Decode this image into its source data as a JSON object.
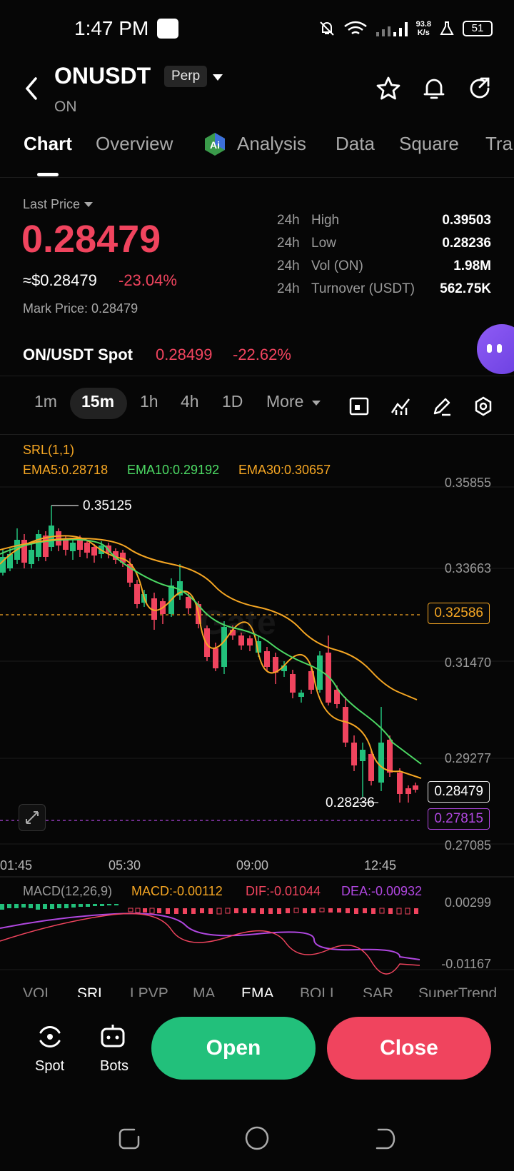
{
  "status_bar": {
    "time": "1:47 PM",
    "net_speed_value": "93.8",
    "net_speed_unit": "K/s",
    "battery": "51"
  },
  "header": {
    "symbol": "ONUSDT",
    "badge": "Perp",
    "subtitle": "ON"
  },
  "tabs": [
    {
      "label": "Chart",
      "active": true
    },
    {
      "label": "Overview"
    },
    {
      "label": "Analysis"
    },
    {
      "label": "Data"
    },
    {
      "label": "Square"
    },
    {
      "label": "Tra"
    }
  ],
  "price": {
    "last_price_label": "Last Price",
    "last_price": "0.28479",
    "usd_price": "≈$0.28479",
    "change": "-23.04%",
    "mark_price": "Mark Price: 0.28479"
  },
  "stats": [
    {
      "period": "24h",
      "label": "High",
      "value": "0.39503"
    },
    {
      "period": "24h",
      "label": "Low",
      "value": "0.28236"
    },
    {
      "period": "24h",
      "label": "Vol (ON)",
      "value": "1.98M"
    },
    {
      "period": "24h",
      "label": "Turnover (USDT)",
      "value": "562.75K"
    }
  ],
  "spot": {
    "label": "ON/USDT Spot",
    "price": "0.28499",
    "change": "-22.62%"
  },
  "timeframes": [
    "1m",
    "15m",
    "1h",
    "4h",
    "1D",
    "More"
  ],
  "active_timeframe": "15m",
  "indicators": {
    "srl": "SRL(1,1)",
    "ema5": "EMA5:0.28718",
    "ema10": "EMA10:0.29192",
    "ema30": "EMA30:0.30657",
    "macd_title": "MACD(12,26,9)",
    "macd": "MACD:-0.00112",
    "dif": "DIF:-0.01044",
    "dea": "DEA:-0.00932"
  },
  "chart_data": {
    "type": "candlestick",
    "y_axis_labels": [
      "0.35855",
      "0.33663",
      "0.31470",
      "0.29277",
      "0.27085"
    ],
    "x_axis_labels": [
      "01:45",
      "05:30",
      "09:00",
      "12:45"
    ],
    "high_marker": "0.35125",
    "low_marker": "0.28236",
    "current_price_tag": "0.28479",
    "dashed_level_orange": "0.32586",
    "dashed_level_purple": "0.27815",
    "macd_axis_labels": [
      "0.00299",
      "-0.01167"
    ],
    "colors": {
      "up": "#22c07b",
      "down": "#f0445e",
      "ema5": "#f5a623",
      "ema10": "#4cd964",
      "ema30": "#f5a623",
      "dea": "#b047e0"
    }
  },
  "indicator_tabs": [
    "VOL",
    "SRL",
    "LPVP",
    "MA",
    "EMA",
    "BOLL",
    "SAR",
    "SuperTrend"
  ],
  "bottom": {
    "spot_label": "Spot",
    "bots_label": "Bots",
    "open_label": "Open",
    "close_label": "Close"
  }
}
